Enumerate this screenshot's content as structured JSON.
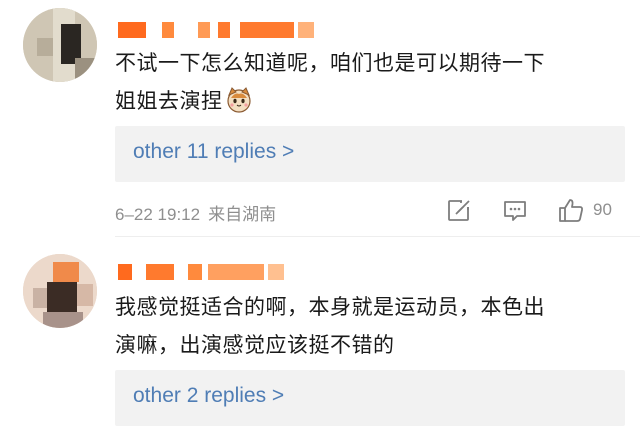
{
  "comments": [
    {
      "text_line1": "不试一下怎么知道呢，咱们也是可以期待一下",
      "text_line2": "姐姐去演捏",
      "emoji": "cat-face",
      "replies_label": "other 11 replies >",
      "timestamp": "6–22 19:12",
      "source": "来自湖南",
      "like_count": "90"
    },
    {
      "text_line1": "我感觉挺适合的啊，本身就是运动员，本色出",
      "text_line2": "演嘛，出演感觉应该挺不错的",
      "replies_label": "other 2 replies >"
    }
  ],
  "icons": {
    "share": "share-icon",
    "comment": "comment-icon",
    "like": "thumbs-up-icon"
  },
  "colors": {
    "link": "#4f7db5",
    "meta": "#8f8f8f",
    "reply_bg": "#f2f2f2",
    "username_censor": "#ff7a2e"
  }
}
